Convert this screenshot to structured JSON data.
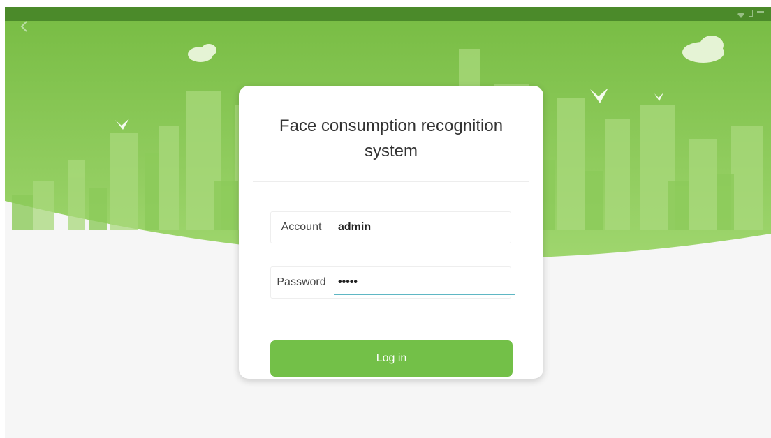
{
  "app": {
    "title_line1": "Face consumption recognition",
    "title_line2": "system"
  },
  "form": {
    "account_label": "Account",
    "account_value": "admin",
    "password_label": "Password",
    "password_value": "•••••",
    "login_label": "Log in"
  },
  "icons": {
    "back": "chevron-left-icon",
    "wifi": "wifi-icon",
    "battery": "battery-icon"
  },
  "colors": {
    "status_bar": "#4b8a2a",
    "header_green": "#7ec24d",
    "button_green": "#73c048",
    "focus_underline": "#5fb7c4"
  }
}
